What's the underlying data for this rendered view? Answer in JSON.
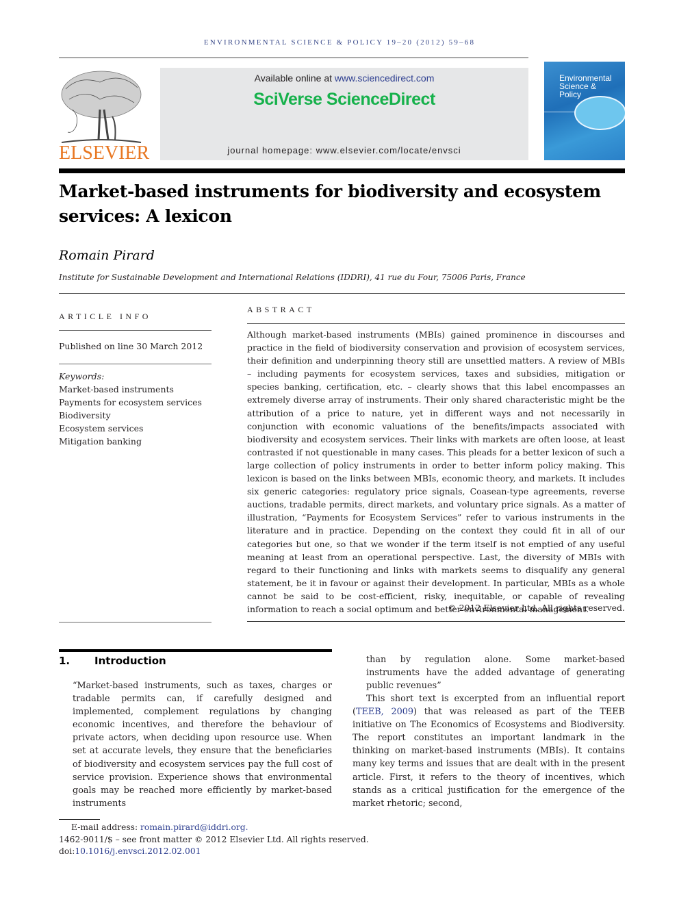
{
  "running_head": "Environmental Science & Policy 19–20 (2012) 59–68",
  "header": {
    "publisher_logo_text": "ELSEVIER",
    "available_prefix": "Available online at ",
    "available_link": "www.sciencedirect.com",
    "platform_name": "SciVerse ScienceDirect",
    "homepage": "journal homepage: www.elsevier.com/locate/envsci",
    "cover_title_lines": [
      "Environmental",
      "Science &",
      "Policy"
    ],
    "colors": {
      "brand_orange": "#e87722",
      "sciverse_green": "#16b14b",
      "link_blue": "#2c3d8f",
      "cover_blue": "#1f6fb8"
    }
  },
  "article": {
    "title": "Market-based instruments for biodiversity and ecosystem services: A lexicon",
    "author": "Romain Pirard",
    "affiliation": "Institute for Sustainable Development and International Relations (IDDRI), 41 rue du Four, 75006 Paris, France"
  },
  "article_info": {
    "label": "Article info",
    "published": "Published on line 30 March 2012",
    "keywords_label": "Keywords:",
    "keywords": [
      "Market-based instruments",
      "Payments for ecosystem services",
      "Biodiversity",
      "Ecosystem services",
      "Mitigation banking"
    ]
  },
  "abstract": {
    "label": "Abstract",
    "text": "Although market-based instruments (MBIs) gained prominence in discourses and practice in the field of biodiversity conservation and provision of ecosystem services, their definition and underpinning theory still are unsettled matters. A review of MBIs – including payments for ecosystem services, taxes and subsidies, mitigation or species banking, certification, etc. – clearly shows that this label encompasses an extremely diverse array of instruments. Their only shared characteristic might be the attribution of a price to nature, yet in different ways and not necessarily in conjunction with economic valuations of the benefits/impacts associated with biodiversity and ecosystem services. Their links with markets are often loose, at least contrasted if not questionable in many cases. This pleads for a better lexicon of such a large collection of policy instruments in order to better inform policy making. This lexicon is based on the links between MBIs, economic theory, and markets. It includes six generic categories: regulatory price signals, Coasean-type agreements, reverse auctions, tradable permits, direct markets, and voluntary price signals. As a matter of illustration, “Payments for Ecosystem Services” refer to various instruments in the literature and in practice. Depending on the context they could fit in all of our categories but one, so that we wonder if the term itself is not emptied of any useful meaning at least from an operational perspective. Last, the diversity of MBIs with regard to their functioning and links with markets seems to disqualify any general statement, be it in favour or against their development. In particular, MBIs as a whole cannot be said to be cost-efficient, risky, inequitable, or capable of revealing information to reach a social optimum and better environmental management.",
    "copyright": "© 2012 Elsevier Ltd. All rights reserved."
  },
  "introduction": {
    "number": "1.",
    "heading": "Introduction",
    "quote_left": "“Market-based instruments, such as taxes, charges or tradable permits can, if carefully designed and implemented, complement regulations by changing economic incentives, and therefore the behaviour of private actors, when deciding upon resource use. When set at accurate levels, they ensure that the beneficiaries of biodiversity and ecosystem services pay the full cost of service provision. Experience shows that environmental goals may be reached more efficiently by market-based instruments",
    "quote_right": "than by regulation alone. Some market-based instruments have the added advantage of generating public revenues”",
    "para_prefix": "This short text is excerpted from an influential report (",
    "para_citation": "TEEB, 2009",
    "para_rest": ") that was released as part of the TEEB initiative on The Economics of Ecosystems and Biodiversity. The report constitutes an important landmark in the thinking on market-based instruments (MBIs). It contains many key terms and issues that are dealt with in the present article. First, it refers to the theory of incentives, which stands as a critical justification for the emergence of the market rhetoric; second,"
  },
  "footnotes": {
    "email_label": "E-mail address: ",
    "email": "romain.pirard@iddri.org.",
    "issn_line": "1462-9011/$ – see front matter © 2012 Elsevier Ltd. All rights reserved.",
    "doi_prefix": "doi:",
    "doi": "10.1016/j.envsci.2012.02.001"
  }
}
